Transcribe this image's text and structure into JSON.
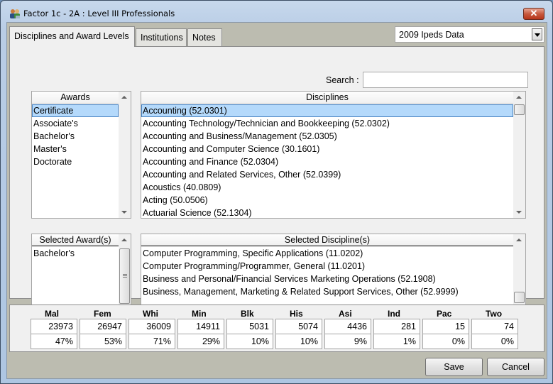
{
  "window": {
    "title": "Factor 1c - 2A : Level III Professionals",
    "icon": "people-icon",
    "close_label": "x"
  },
  "tabs": [
    {
      "label": "Disciplines and Award Levels",
      "active": true
    },
    {
      "label": "Institutions",
      "active": false
    },
    {
      "label": "Notes",
      "active": false
    }
  ],
  "data_source": {
    "selected": "2009 Ipeds Data"
  },
  "search": {
    "label": "Search :",
    "value": ""
  },
  "awards": {
    "header": "Awards",
    "items": [
      "Certificate",
      "Associate's",
      "Bachelor's",
      "Master's",
      "Doctorate"
    ],
    "selected_index": 0
  },
  "disciplines": {
    "header": "Disciplines",
    "items": [
      "Accounting (52.0301)",
      "Accounting Technology/Technician and Bookkeeping (52.0302)",
      "Accounting and Business/Management (52.0305)",
      "Accounting and Computer Science (30.1601)",
      "Accounting and Finance (52.0304)",
      "Accounting and Related Services, Other (52.0399)",
      "Acoustics (40.0809)",
      "Acting (50.0506)",
      "Actuarial Science (52.1304)"
    ],
    "selected_index": 0
  },
  "selected_awards": {
    "header": "Selected Award(s)",
    "items": [
      "Bachelor's"
    ]
  },
  "selected_disciplines": {
    "header": "Selected Discipline(s)",
    "items": [
      "Computer Programming, Specific Applications (11.0202)",
      "Computer Programming/Programmer, General (11.0201)",
      "Business and Personal/Financial Services Marketing Operations (52.1908)",
      "Business, Management, Marketing & Related Support Services, Other (52.9999)"
    ]
  },
  "stats": [
    {
      "label": "Mal",
      "count": "23973",
      "percent": "47%"
    },
    {
      "label": "Fem",
      "count": "26947",
      "percent": "53%"
    },
    {
      "label": "Whi",
      "count": "36009",
      "percent": "71%"
    },
    {
      "label": "Min",
      "count": "14911",
      "percent": "29%"
    },
    {
      "label": "Blk",
      "count": "5031",
      "percent": "10%"
    },
    {
      "label": "His",
      "count": "5074",
      "percent": "10%"
    },
    {
      "label": "Asi",
      "count": "4436",
      "percent": "9%"
    },
    {
      "label": "Ind",
      "count": "281",
      "percent": "1%"
    },
    {
      "label": "Pac",
      "count": "15",
      "percent": "0%"
    },
    {
      "label": "Two",
      "count": "74",
      "percent": "0%"
    }
  ],
  "buttons": {
    "save": "Save",
    "cancel": "Cancel"
  }
}
